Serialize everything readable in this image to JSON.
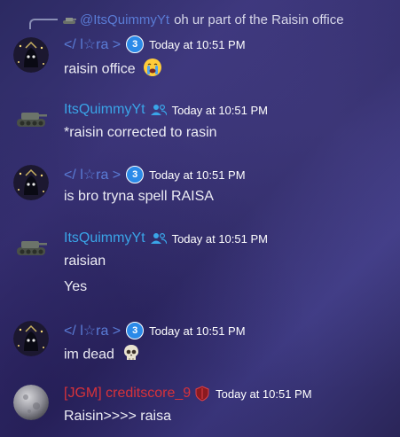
{
  "reply": {
    "name": "@ItsQuimmyYt",
    "text": "oh ur part of the Raisin office"
  },
  "messages": [
    {
      "author": "</ l☆ra >",
      "badge": "3",
      "timestamp": "Today at 10:51 PM",
      "lines": [
        "raisin office"
      ],
      "emoji": "crying-face"
    },
    {
      "author": "ItsQuimmyYt",
      "timestamp": "Today at 10:51 PM",
      "lines": [
        "*raisin corrected to rasin"
      ]
    },
    {
      "author": "</ l☆ra >",
      "badge": "3",
      "timestamp": "Today at 10:51 PM",
      "lines": [
        "is bro tryna spell RAISA"
      ]
    },
    {
      "author": "ItsQuimmyYt",
      "timestamp": "Today at 10:51 PM",
      "lines": [
        "raisian",
        "Yes"
      ]
    },
    {
      "author": "</ l☆ra >",
      "badge": "3",
      "timestamp": "Today at 10:51 PM",
      "lines": [
        "im dead"
      ],
      "emoji": "skull"
    },
    {
      "author": "[JGM] creditscore_9",
      "timestamp": "Today at 10:51 PM",
      "lines": [
        "Raisin>>>> raisa"
      ]
    }
  ],
  "colors": {
    "lara_name": "#5a7cd6",
    "quimmy_name": "#3aa5e8",
    "credit_name": "#d8323a",
    "badge": "#2b8ae8"
  }
}
